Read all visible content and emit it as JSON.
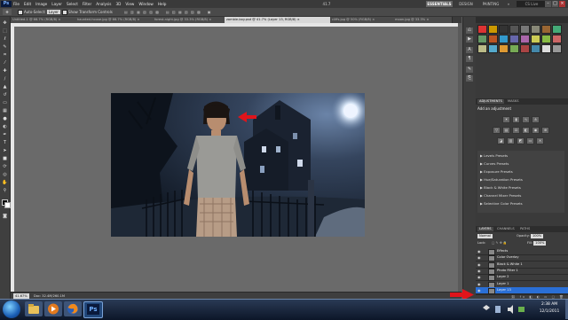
{
  "menubar": {
    "app_badge": "Ps",
    "items": [
      "File",
      "Edit",
      "Image",
      "Layer",
      "Select",
      "Filter",
      "Analysis",
      "3D",
      "View",
      "Window",
      "Help"
    ],
    "zoom": "41.7",
    "workspaces": [
      "ESSENTIALS",
      "DESIGN",
      "PAINTING",
      "»"
    ],
    "cs_live": "CS Live",
    "window_controls": [
      "–",
      "□",
      "×"
    ]
  },
  "options": {
    "auto_select_label": "Auto-Select:",
    "auto_select_value": "Layer",
    "show_transform_label": "Show Transform Controls"
  },
  "tabs": [
    {
      "label": "Untitled-1 @ 66.7% (RGB/8) ×",
      "active": false
    },
    {
      "label": "haunted-house.jpg @ 66.7% (RGB/8) ×",
      "active": false
    },
    {
      "label": "forest-night.jpg @ 33.3% (RGB/8) ×",
      "active": false
    },
    {
      "label": "zombie-boy.psd @ 41.7% (Layer 13, RGB/8) ×",
      "active": true
    },
    {
      "label": "cliffs.jpg @ 50% (RGB/8) ×",
      "active": false
    },
    {
      "label": "moon.jpg @ 33.3% ×",
      "active": false
    }
  ],
  "status": {
    "zoom": "41.67%",
    "doc": "Doc: 32.4M/260.1M"
  },
  "adjustments": {
    "tabs": [
      "ADJUSTMENTS",
      "MASKS"
    ],
    "title": "Add an adjustment",
    "presets": [
      "Levels Presets",
      "Curves Presets",
      "Exposure Presets",
      "Hue/Saturation Presets",
      "Black & White Presets",
      "Channel Mixer Presets",
      "Selective Color Presets"
    ]
  },
  "layers_panel": {
    "tabs": [
      "LAYERS",
      "CHANNELS",
      "PATHS"
    ],
    "blend_mode": "Normal",
    "opacity_label": "Opacity:",
    "opacity_value": "100%",
    "lock_label": "Lock:",
    "fill_label": "Fill:",
    "fill_value": "100%",
    "layers": [
      {
        "name": "Effects",
        "selected": false
      },
      {
        "name": "Color Overlay",
        "selected": false
      },
      {
        "name": "Black & White 1",
        "selected": false
      },
      {
        "name": "Photo Filter 1",
        "selected": false
      },
      {
        "name": "Layer 2",
        "selected": false
      },
      {
        "name": "Layer 1",
        "selected": false
      },
      {
        "name": "Layer 13",
        "selected": true
      }
    ]
  },
  "clock": {
    "time": "2:38 AM",
    "date": "12/1/2011"
  },
  "colors": {
    "accent": "#2a6fd6",
    "arrow": "#e0141b",
    "panel": "#3a3a3a"
  }
}
